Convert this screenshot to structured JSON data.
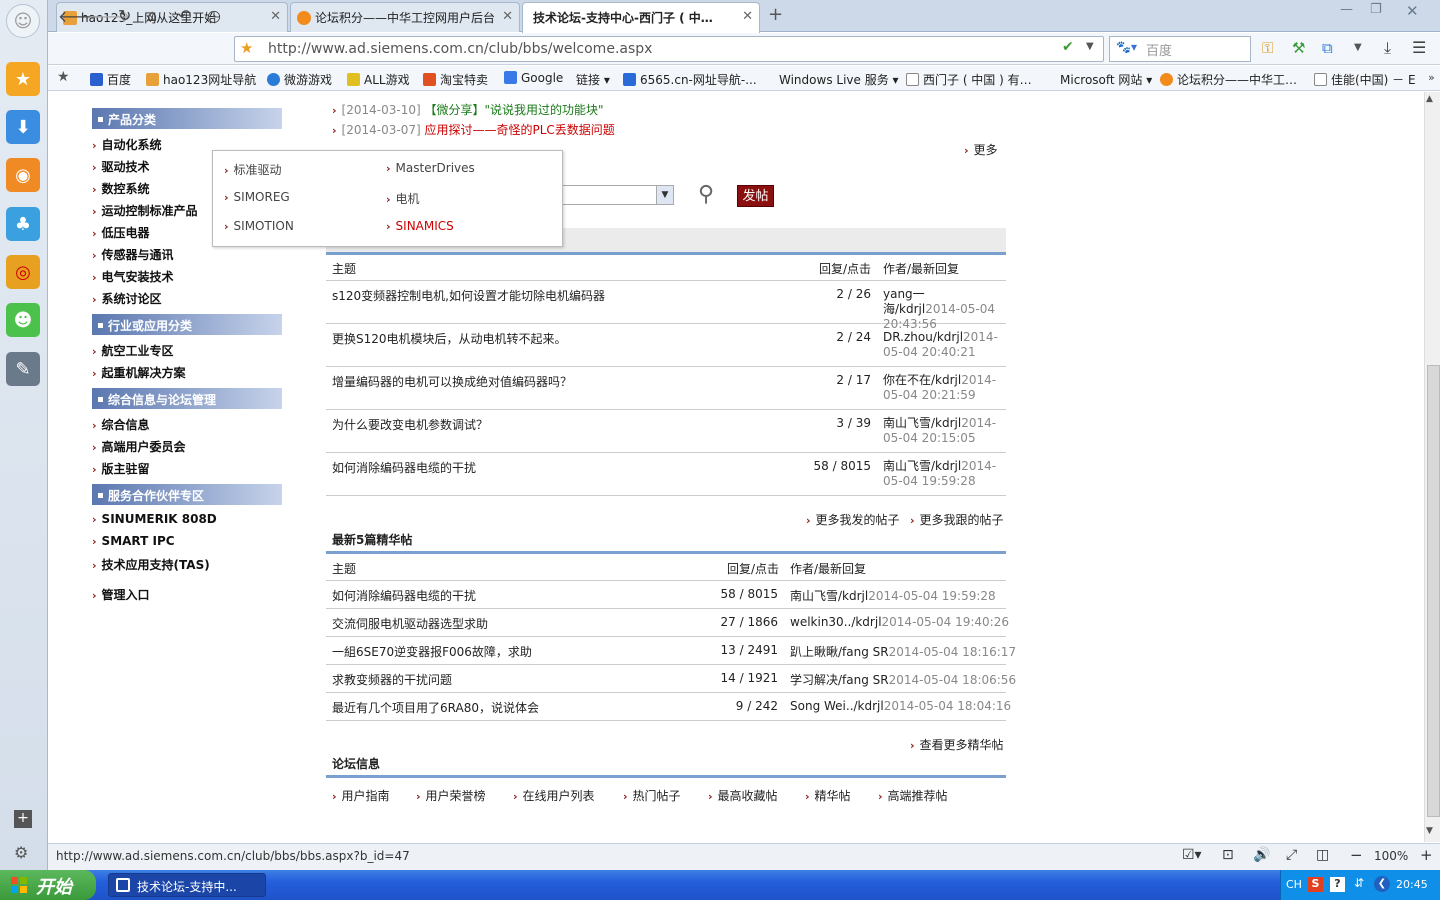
{
  "browser": {
    "tabs": [
      {
        "title": "hao123_上网从这里开始"
      },
      {
        "title": "论坛积分——中华工控网用户后台"
      },
      {
        "title": "技术论坛-支持中心-西门子 ( 中…"
      }
    ],
    "url": "http://www.ad.siemens.com.cn/club/bbs/welcome.aspx",
    "search_placeholder": "百度",
    "bookmarks": [
      "百度",
      "hao123网址导航",
      "微游游戏",
      "ALL游戏",
      "淘宝特卖",
      "Google",
      "链接",
      "6565.cn-网址导航-...",
      "Windows Live 服务",
      "西门子 ( 中国 ) 有…",
      "Microsoft 网站",
      "论坛积分——中华工…",
      "佳能(中国) － E"
    ],
    "status_url": "http://www.ad.siemens.com.cn/club/bbs/bbs.aspx?b_id=47",
    "zoom": "100%"
  },
  "taskbar": {
    "start_label": "开始",
    "task_label": "技术论坛-支持中...",
    "tray_lang": "CH",
    "clock": "20:45"
  },
  "sidebar": {
    "sections": [
      {
        "title": "产品分类",
        "items": [
          "自动化系统",
          "驱动技术",
          "数控系统",
          "运动控制标准产品",
          "低压电器",
          "传感器与通讯",
          "电气安装技术",
          "系统讨论区"
        ]
      },
      {
        "title": "行业或应用分类",
        "items": [
          "航空工业专区",
          "起重机解决方案"
        ]
      },
      {
        "title": "综合信息与论坛管理",
        "items": [
          "综合信息",
          "高端用户委员会",
          "版主驻留"
        ]
      },
      {
        "title": "服务合作伙伴专区",
        "items": [
          "SINUMERIK 808D",
          "SMART IPC",
          "技术应用支持(TAS)"
        ]
      }
    ],
    "admin_entry": "管理入口"
  },
  "popup_menu": {
    "items": [
      "标准驱动",
      "MasterDrives",
      "SIMOREG",
      "电机",
      "SIMOTION",
      "SINAMICS"
    ]
  },
  "news": [
    {
      "date": "[2014-03-10]",
      "title": "【微分享】\"说说我用过的功能块\""
    },
    {
      "date": "[2014-03-07]",
      "title": "应用探讨——奇怪的PLC丢数据问题"
    }
  ],
  "news_more": "更多",
  "post_button": "发帖",
  "my_posts": {
    "headers": [
      "主题",
      "回复/点击",
      "作者/最新回复"
    ],
    "rows": [
      {
        "topic": "s120变频器控制电机,如何设置才能切除电机编码器",
        "count": "2 / 26",
        "author": "yang一海/kdrjl",
        "time": "2014-05-04 20:43:56"
      },
      {
        "topic": "更换S120电机模块后，从动电机转不起来。",
        "count": "2 / 24",
        "author": "DR.zhou/kdrjl",
        "time": "2014-05-04 20:40:21"
      },
      {
        "topic": "增量编码器的电机可以换成绝对值编码器吗？",
        "count": "2 / 17",
        "author": "你在不在/kdrjl",
        "time": "2014-05-04 20:21:59"
      },
      {
        "topic": "为什么要改变电机参数调试？",
        "count": "3 / 39",
        "author": "南山飞雪/kdrjl",
        "time": "2014-05-04 20:15:05"
      },
      {
        "topic": "如何消除编码器电缆的干扰",
        "count": "58 / 8015",
        "author": "南山飞雪/kdrjl",
        "time": "2014-05-04 19:59:28"
      }
    ],
    "more_mine": "更多我发的帖子",
    "more_followed": "更多我跟的帖子"
  },
  "featured": {
    "title": "最新5篇精华帖",
    "headers": [
      "主题",
      "回复/点击",
      "作者/最新回复"
    ],
    "rows": [
      {
        "topic": "如何消除编码器电缆的干扰",
        "count": "58 / 8015",
        "author": "南山飞雪/kdrjl",
        "time": "2014-05-04 19:59:28"
      },
      {
        "topic": "交流伺服电机驱动器选型求助",
        "count": "27 / 1866",
        "author": "welkin30../kdrjl",
        "time": "2014-05-04 19:40:26"
      },
      {
        "topic": "一組6SE70逆变器报F006故障，求助",
        "count": "13 / 2491",
        "author": "趴上瞅瞅/fang SR",
        "time": "2014-05-04 18:16:17"
      },
      {
        "topic": "求教变频器的干扰问题",
        "count": "14 / 1921",
        "author": "学习解决/fang SR",
        "time": "2014-05-04 18:06:56"
      },
      {
        "topic": "最近有几个项目用了6RA80，说说体会",
        "count": "9 / 242",
        "author": "Song Wei../kdrjl",
        "time": "2014-05-04 18:04:16"
      }
    ],
    "more": "查看更多精华帖"
  },
  "forum_info": {
    "title": "论坛信息",
    "links": [
      "用户指南",
      "用户荣誉榜",
      "在线用户列表",
      "热门帖子",
      "最高收藏帖",
      "精华帖",
      "高端推荐帖"
    ]
  },
  "colors": {
    "accent_red": "#8a1c1c",
    "nav_blue": "#5a77b0",
    "link_green": "#1a7a1a",
    "news_red": "#cc0000"
  }
}
